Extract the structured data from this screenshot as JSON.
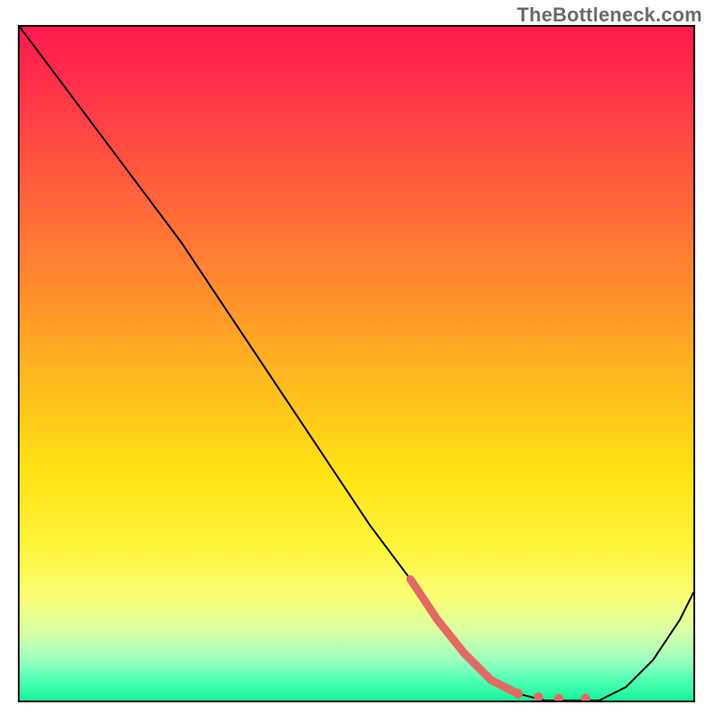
{
  "watermark": "TheBottleneck.com",
  "chart_data": {
    "type": "line",
    "title": "",
    "xlabel": "",
    "ylabel": "",
    "xlim": [
      0,
      100
    ],
    "ylim": [
      0,
      100
    ],
    "grid": false,
    "gradient_stops": [
      {
        "pos": 0,
        "color": "#ff1a4d"
      },
      {
        "pos": 8,
        "color": "#ff2e4b"
      },
      {
        "pos": 22,
        "color": "#ff5a3d"
      },
      {
        "pos": 38,
        "color": "#ff8a2e"
      },
      {
        "pos": 52,
        "color": "#ffb81f"
      },
      {
        "pos": 66,
        "color": "#ffe214"
      },
      {
        "pos": 77,
        "color": "#fff43a"
      },
      {
        "pos": 85,
        "color": "#faff78"
      },
      {
        "pos": 90,
        "color": "#d6ffa6"
      },
      {
        "pos": 94,
        "color": "#9cffc0"
      },
      {
        "pos": 97,
        "color": "#4fffb3"
      },
      {
        "pos": 100,
        "color": "#14f59a"
      }
    ],
    "series": [
      {
        "name": "main-curve",
        "color": "#000000",
        "stroke_width": 2,
        "x": [
          0,
          6,
          12,
          18,
          24,
          28,
          34,
          40,
          46,
          52,
          58,
          62,
          66,
          70,
          74,
          78,
          82,
          86,
          90,
          94,
          98,
          100
        ],
        "y": [
          100,
          92,
          84,
          76,
          68,
          62,
          53,
          44,
          35,
          26,
          18,
          12,
          7,
          3,
          1,
          0,
          0,
          0,
          2,
          6,
          12,
          16
        ]
      },
      {
        "name": "highlight-segment",
        "color": "#e26a63",
        "stroke_width": 9,
        "x": [
          58,
          62,
          66,
          70,
          74
        ],
        "y": [
          18,
          12,
          7,
          3,
          1
        ]
      }
    ],
    "highlight_dots": {
      "color": "#e26a63",
      "radius": 4.5,
      "points": [
        {
          "x": 74,
          "y": 1
        },
        {
          "x": 77,
          "y": 0.5
        },
        {
          "x": 80,
          "y": 0.3
        },
        {
          "x": 84,
          "y": 0.3
        }
      ]
    }
  }
}
